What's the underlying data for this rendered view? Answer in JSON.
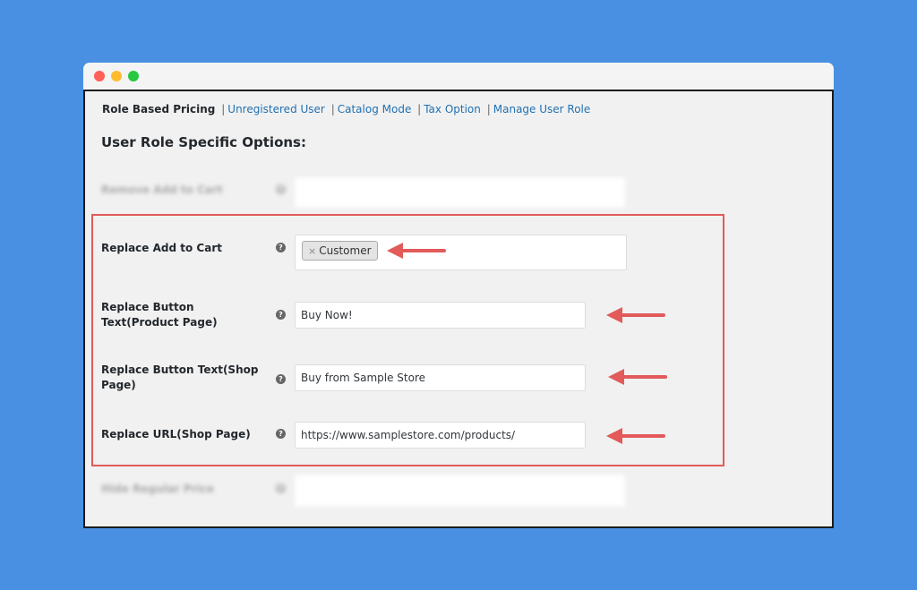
{
  "window": {
    "controls": [
      "close",
      "minimize",
      "maximize"
    ]
  },
  "tabs": {
    "active": "Role Based Pricing",
    "links": [
      "Unregistered User",
      "Catalog Mode",
      "Tax Option",
      "Manage User Role"
    ],
    "separator": "|"
  },
  "page_title": "User Role Specific Options:",
  "help_glyph": "?",
  "rows": {
    "blurred_top": {
      "label": "Remove Add to Cart"
    },
    "replace_add_to_cart": {
      "label": "Replace Add to Cart",
      "tag_remove": "×",
      "tag": "Customer"
    },
    "product_button_text": {
      "label": "Replace Button Text(Product Page)",
      "value": "Buy Now!"
    },
    "shop_button_text": {
      "label": "Replace Button Text(Shop Page)",
      "value": "Buy from Sample Store"
    },
    "shop_url": {
      "label": "Replace URL(Shop Page)",
      "value": "https://www.samplestore.com/products/"
    },
    "blurred_bottom": {
      "label": "Hide Regular Price"
    }
  },
  "colors": {
    "background": "#4a90e2",
    "highlight": "#e25a5a",
    "link": "#2271b1"
  }
}
